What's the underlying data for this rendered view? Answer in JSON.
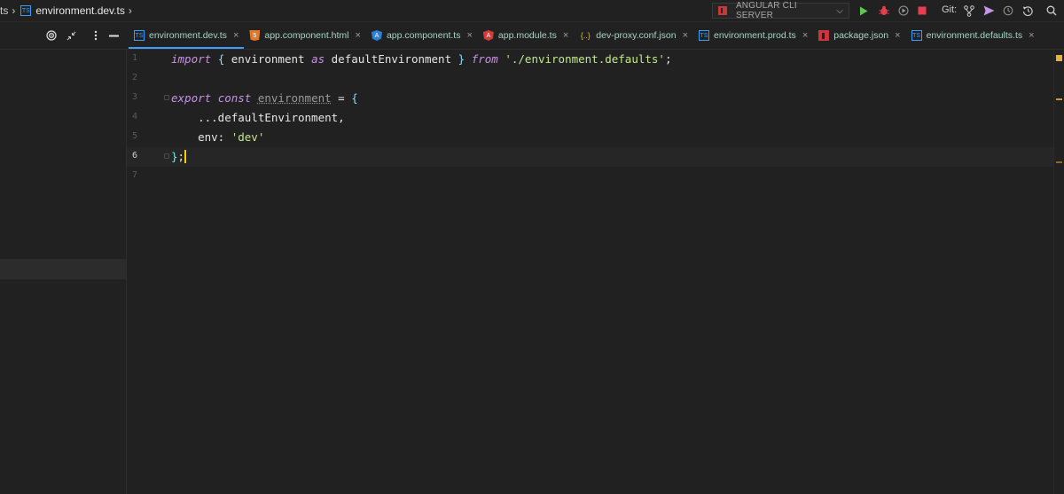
{
  "breadcrumb": {
    "parent": "ts",
    "file": "environment.dev.ts",
    "file_icon": "TS"
  },
  "toolbar": {
    "run_config_label": "ANGULAR CLI SERVER",
    "git_label": "Git:",
    "colors": {
      "run": "#62c554",
      "debug": "#e2404f",
      "stop": "#e2404f",
      "git_push": "#c792ea"
    }
  },
  "tabs": [
    {
      "label": "environment.dev.ts",
      "icon": "ts",
      "icon_text": "TS",
      "active": true
    },
    {
      "label": "app.component.html",
      "icon": "html",
      "icon_text": "5",
      "active": false
    },
    {
      "label": "app.component.ts",
      "icon": "ng",
      "icon_text": "A",
      "active": false
    },
    {
      "label": "app.module.ts",
      "icon": "ngred",
      "icon_text": "A",
      "active": false
    },
    {
      "label": "dev-proxy.conf.json",
      "icon": "json",
      "icon_text": "{..}",
      "active": false
    },
    {
      "label": "environment.prod.ts",
      "icon": "ts",
      "icon_text": "TS",
      "active": false
    },
    {
      "label": "package.json",
      "icon": "npm",
      "icon_text": "",
      "active": false
    },
    {
      "label": "environment.defaults.ts",
      "icon": "ts",
      "icon_text": "TS",
      "active": false
    }
  ],
  "editor": {
    "current_line": 6,
    "lines": [
      {
        "n": "1",
        "tokens": [
          {
            "t": "import",
            "c": "kw"
          },
          {
            "t": " ",
            "c": "pl"
          },
          {
            "t": "{",
            "c": "br"
          },
          {
            "t": " environment ",
            "c": "pl"
          },
          {
            "t": "as",
            "c": "kw"
          },
          {
            "t": " defaultEnvironment ",
            "c": "pl"
          },
          {
            "t": "}",
            "c": "br"
          },
          {
            "t": " ",
            "c": "pl"
          },
          {
            "t": "from",
            "c": "kw"
          },
          {
            "t": " ",
            "c": "pl"
          },
          {
            "t": "'./environment.defaults'",
            "c": "str"
          },
          {
            "t": ";",
            "c": "pl"
          }
        ]
      },
      {
        "n": "2",
        "tokens": []
      },
      {
        "n": "3",
        "fold": true,
        "tokens": [
          {
            "t": "export",
            "c": "kw"
          },
          {
            "t": " ",
            "c": "pl"
          },
          {
            "t": "const",
            "c": "kw"
          },
          {
            "t": " ",
            "c": "pl"
          },
          {
            "t": "environment",
            "c": "uline"
          },
          {
            "t": " = ",
            "c": "pl"
          },
          {
            "t": "{",
            "c": "br"
          }
        ]
      },
      {
        "n": "4",
        "tokens": [
          {
            "t": "    ...defaultEnvironment,",
            "c": "pl"
          }
        ]
      },
      {
        "n": "5",
        "tokens": [
          {
            "t": "    env: ",
            "c": "pl"
          },
          {
            "t": "'dev'",
            "c": "str"
          }
        ]
      },
      {
        "n": "6",
        "fold": true,
        "caret": true,
        "tokens": [
          {
            "t": "}",
            "c": "br"
          },
          {
            "t": ";",
            "c": "pl"
          }
        ]
      },
      {
        "n": "7",
        "tokens": []
      }
    ]
  }
}
